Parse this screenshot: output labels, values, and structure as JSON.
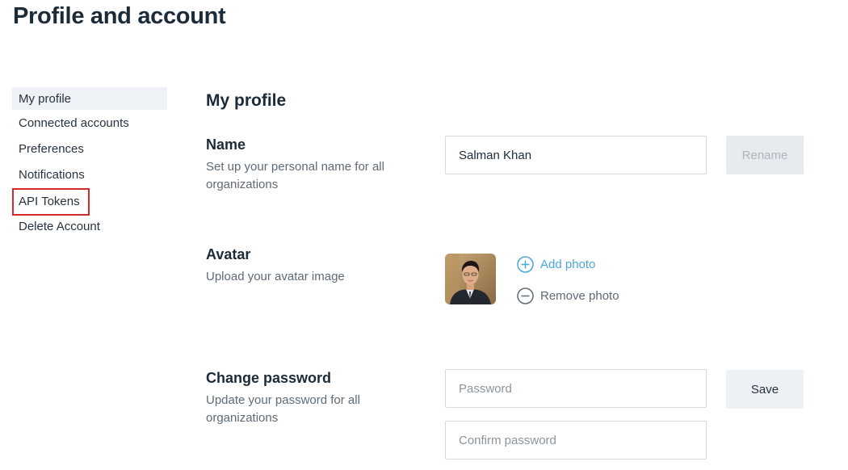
{
  "page": {
    "title": "Profile and account"
  },
  "sidebar": {
    "items": [
      {
        "label": "My profile"
      },
      {
        "label": "Connected accounts"
      },
      {
        "label": "Preferences"
      },
      {
        "label": "Notifications"
      },
      {
        "label": "API Tokens"
      },
      {
        "label": "Delete Account"
      }
    ],
    "active": "My profile",
    "highlighted": "API Tokens",
    "highlight_color": "#d22a2a"
  },
  "main": {
    "section_title": "My profile",
    "name": {
      "label": "Name",
      "description": "Set up your personal name for all organizations",
      "value": "Salman Khan",
      "button_label": "Rename"
    },
    "avatar": {
      "label": "Avatar",
      "description": "Upload your avatar image",
      "add_label": "Add photo",
      "remove_label": "Remove photo",
      "add_icon": "plus-circle-icon",
      "remove_icon": "minus-circle-icon"
    },
    "password": {
      "label": "Change password",
      "description": "Update your password for all organizations",
      "password_placeholder": "Password",
      "confirm_placeholder": "Confirm password",
      "button_label": "Save"
    }
  },
  "colors": {
    "accent": "#4aa8d8",
    "text": "#1c2b39",
    "muted": "#5e6a75"
  }
}
